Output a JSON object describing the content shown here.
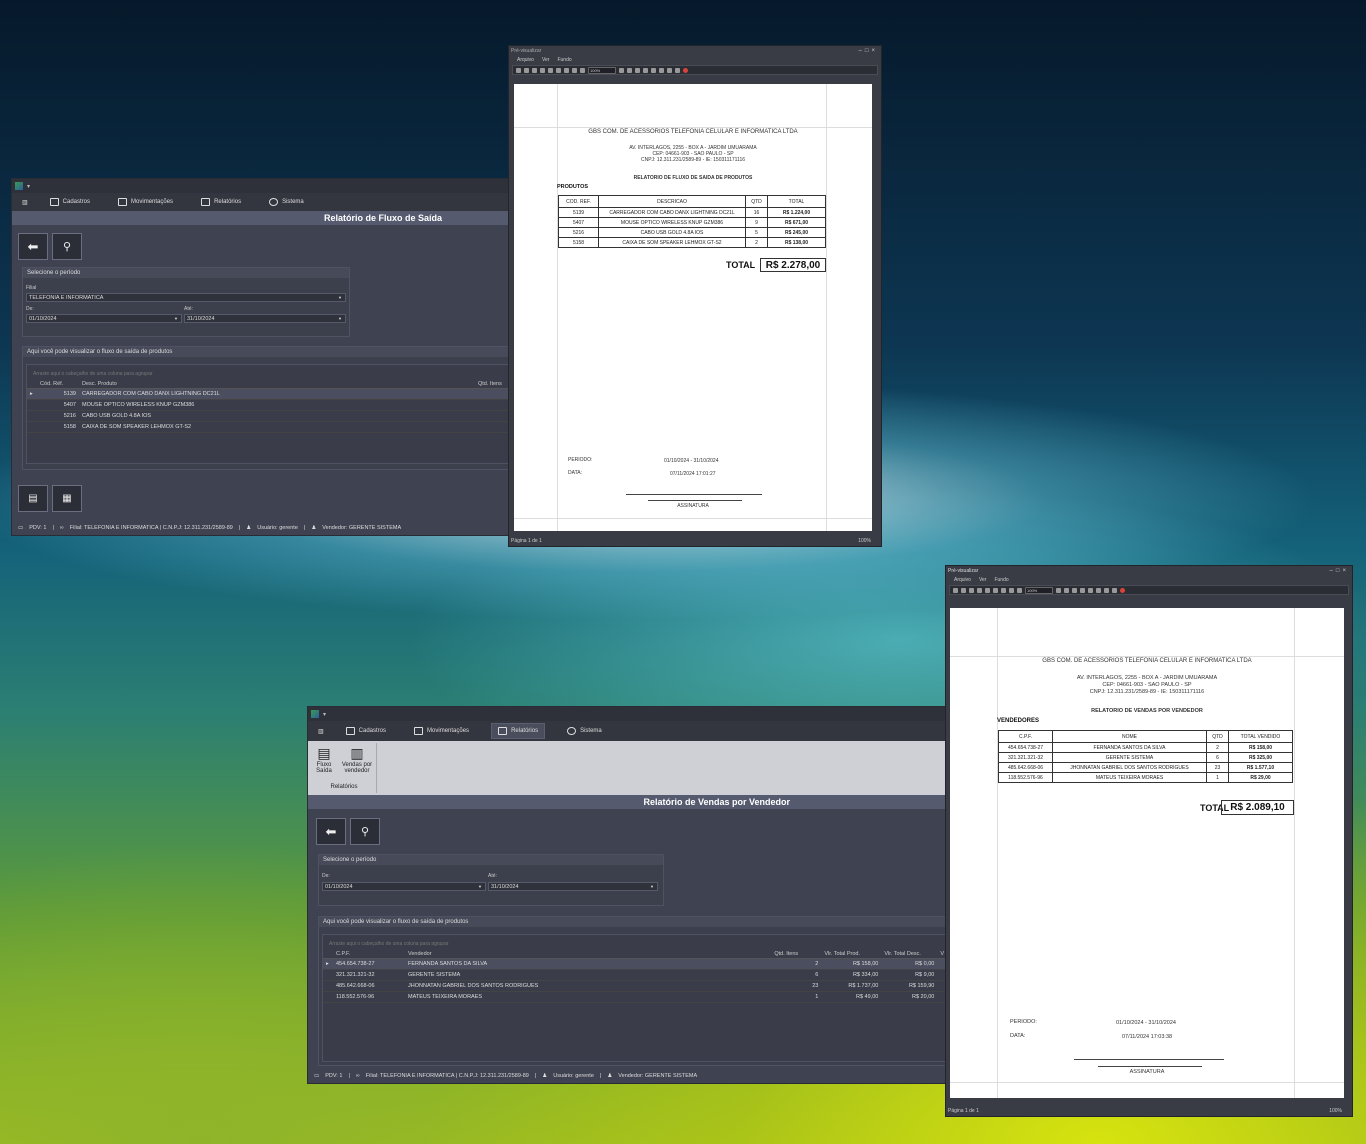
{
  "window1": {
    "menu": [
      "Cadastros",
      "Movimentações",
      "Relatórios",
      "Sistema"
    ],
    "title": "Relatório de Fluxo de Saída",
    "period_group": "Selecione o período",
    "filial_label": "Filial",
    "filial_value": "TELEFONIA E INFORMATICA",
    "de_label": "De:",
    "de_value": "01/10/2024",
    "ate_label": "Até:",
    "ate_value": "31/10/2024",
    "grid_group": "Aqui você pode visualizar o fluxo de saída de produtos",
    "grid_hint": "Arraste aqui o cabeçalho de uma coluna para agrupar",
    "columns": [
      "Cód. Réf.",
      "Desc. Produto",
      "Qtd. Itens"
    ],
    "rows": [
      {
        "ref": "5139",
        "desc": "CARREGADOR COM CABO DANX LIGHTNING DC21L"
      },
      {
        "ref": "5407",
        "desc": "MOUSE OPTICO WIRELESS KNUP GZM386"
      },
      {
        "ref": "5216",
        "desc": "CABO USB GOLD 4.8A IOS"
      },
      {
        "ref": "5158",
        "desc": "CAIXA DE SOM SPEAKER LEHMOX GT-S2"
      }
    ],
    "status": {
      "pdv": "PDV: 1",
      "filial": "Filial: TELEFONIA E INFORMATICA | C.N.P.J: 12.311.231/2589-89",
      "usuario": "Usuário: gerente",
      "vendedor": "Vendedor: GERENTE SISTEMA"
    }
  },
  "preview1": {
    "title": "Pré-visualizar",
    "menu": [
      "Arquivo",
      "Ver",
      "Fundo"
    ],
    "zoom": "100%",
    "company": "GBS COM. DE ACESSORIOS TELEFONIA CELULAR E INFORMATICA LTDA",
    "addr1": "AV. INTERLAGOS, 2255 - BOX A - JARDIM UMUARAMA",
    "addr2": "CEP: 04661-903 - SAO PAULO - SP",
    "addr3": "CNPJ: 12.311.231/2589-89 - IE: 150311171116",
    "report_title": "RELATORIO DE FLUXO DE SAIDA DE PRODUTOS",
    "section": "PRODUTOS",
    "headers": [
      "COD. REF.",
      "DESCRICAO",
      "QTD",
      "TOTAL"
    ],
    "rows": [
      {
        "ref": "5139",
        "desc": "CARREGADOR COM CABO DANX LIGHTNING DC21L",
        "qtd": "16",
        "total": "R$ 1.224,00"
      },
      {
        "ref": "5407",
        "desc": "MOUSE OPTICO WIRELESS KNUP GZM386",
        "qtd": "9",
        "total": "R$ 671,00"
      },
      {
        "ref": "5216",
        "desc": "CABO USB GOLD 4.8A IOS",
        "qtd": "5",
        "total": "R$ 245,00"
      },
      {
        "ref": "5158",
        "desc": "CAIXA DE SOM SPEAKER LEHMOX GT-S2",
        "qtd": "2",
        "total": "R$ 138,00"
      }
    ],
    "total_label": "TOTAL",
    "total_value": "R$ 2.278,00",
    "periodo_label": "PERIODO:",
    "periodo_value": "01/10/2024 - 31/10/2024",
    "data_label": "DATA:",
    "data_value": "07/11/2024 17:01:27",
    "assinatura": "ASSINATURA",
    "page_info": "Página 1 de 1",
    "zoom_status": "100%"
  },
  "window2": {
    "menu": [
      "Cadastros",
      "Movimentações",
      "Relatórios",
      "Sistema"
    ],
    "ribbon_items": [
      "Fluxo Saída",
      "Vendas por vendedor"
    ],
    "ribbon_group": "Relatórios",
    "title": "Relatório de Vendas por Vendedor",
    "period_group": "Selecione o período",
    "de_label": "De:",
    "de_value": "01/10/2024",
    "ate_label": "Até:",
    "ate_value": "31/10/2024",
    "grid_group": "Aqui você pode visualizar o fluxo de saída de produtos",
    "grid_hint": "Arraste aqui o cabeçalho de uma coluna para agrupar",
    "columns": [
      "C.P.F.",
      "Vendedor",
      "Qtd. Itens",
      "Vlr. Total Prod.",
      "Vlr. Total Desc.",
      "V"
    ],
    "rows": [
      {
        "cpf": "454.654.738-27",
        "nome": "FERNANDA SANTOS DA SILVA",
        "qtd": "2",
        "prod": "R$ 158,00",
        "desc": "R$ 0,00"
      },
      {
        "cpf": "321.321.321-32",
        "nome": "GERENTE SISTEMA",
        "qtd": "6",
        "prod": "R$ 334,00",
        "desc": "R$ 9,00"
      },
      {
        "cpf": "485.642.668-06",
        "nome": "JHONNATAN GABRIEL DOS SANTOS RODRIGUES",
        "qtd": "23",
        "prod": "R$ 1.737,00",
        "desc": "R$ 159,90"
      },
      {
        "cpf": "118.552.576-96",
        "nome": "MATEUS TEIXEIRA MORAES",
        "qtd": "1",
        "prod": "R$ 49,00",
        "desc": "R$ 20,00"
      }
    ],
    "status": {
      "pdv": "PDV: 1",
      "filial": "Filial: TELEFONIA E INFORMATICA | C.N.P.J: 12.311.231/2589-89",
      "usuario": "Usuário: gerente",
      "vendedor": "Vendedor: GERENTE SISTEMA"
    }
  },
  "preview2": {
    "title": "Pré-visualizar",
    "menu": [
      "Arquivo",
      "Ver",
      "Fundo"
    ],
    "zoom": "100%",
    "company": "GBS COM. DE ACESSORIOS TELEFONIA CELULAR E INFORMATICA LTDA",
    "addr1": "AV. INTERLAGOS, 2255 - BOX A - JARDIM UMUARAMA",
    "addr2": "CEP: 04661-903 - SAO PAULO - SP",
    "addr3": "CNPJ: 12.311.231/2589-89 - IE: 150311171116",
    "report_title": "RELATORIO DE VENDAS POR VENDEDOR",
    "section": "VENDEDORES",
    "headers": [
      "C.P.F.",
      "NOME",
      "QTD",
      "TOTAL VENDIDO"
    ],
    "rows": [
      {
        "cpf": "454.654.738-27",
        "nome": "FERNANDA SANTOS DA SILVA",
        "qtd": "2",
        "total": "R$ 158,00"
      },
      {
        "cpf": "321.321.321-32",
        "nome": "GERENTE SISTEMA",
        "qtd": "6",
        "total": "R$ 325,00"
      },
      {
        "cpf": "485.642.668-06",
        "nome": "JHONNATAN GABRIEL DOS SANTOS RODRIGUES",
        "qtd": "23",
        "total": "R$ 1.577,10"
      },
      {
        "cpf": "118.552.576-96",
        "nome": "MATEUS TEIXEIRA MORAES",
        "qtd": "1",
        "total": "R$ 29,00"
      }
    ],
    "total_label": "TOTAL",
    "total_value": "R$ 2.089,10",
    "periodo_label": "PERIODO:",
    "periodo_value": "01/10/2024 - 31/10/2024",
    "data_label": "DATA:",
    "data_value": "07/11/2024 17:03:38",
    "assinatura": "ASSINATURA",
    "page_info": "Página 1 de 1",
    "zoom_status": "100%"
  }
}
